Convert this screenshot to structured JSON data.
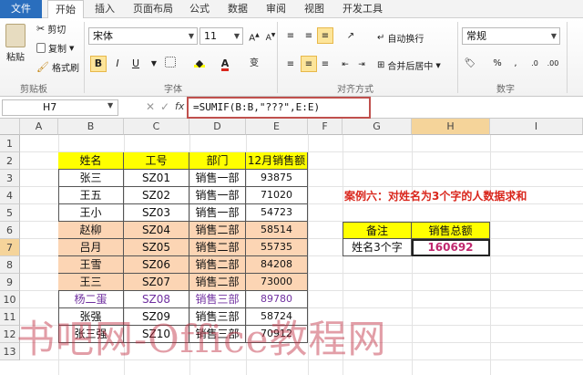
{
  "ribbon_tabs": [
    "文件",
    "开始",
    "插入",
    "页面布局",
    "公式",
    "数据",
    "审阅",
    "视图",
    "开发工具"
  ],
  "clipboard": {
    "paste": "粘贴",
    "cut": "剪切",
    "copy": "复制",
    "format_painter": "格式刷",
    "label": "剪贴板"
  },
  "font": {
    "name": "宋体",
    "size": "11",
    "label": "字体",
    "bold": "B",
    "italic": "I",
    "underline": "U"
  },
  "alignment": {
    "wrap": "自动换行",
    "merge": "合并后居中",
    "label": "对齐方式"
  },
  "number": {
    "format": "常规",
    "label": "数字"
  },
  "formula_bar": {
    "name_box": "H7",
    "fx": "fx",
    "formula": "=SUMIF(B:B,\"???\",E:E)"
  },
  "columns": [
    "A",
    "B",
    "C",
    "D",
    "E",
    "F",
    "G",
    "H",
    "I"
  ],
  "rows": [
    "1",
    "2",
    "3",
    "4",
    "5",
    "6",
    "7",
    "8",
    "9",
    "10",
    "11",
    "12",
    "13"
  ],
  "table": {
    "headers": [
      "姓名",
      "工号",
      "部门",
      "12月销售额"
    ],
    "data": [
      [
        "张三",
        "SZ01",
        "销售一部",
        "93875"
      ],
      [
        "王五",
        "SZ02",
        "销售一部",
        "71020"
      ],
      [
        "王小",
        "SZ03",
        "销售一部",
        "54723"
      ],
      [
        "赵柳",
        "SZ04",
        "销售二部",
        "58514"
      ],
      [
        "吕月",
        "SZ05",
        "销售二部",
        "55735"
      ],
      [
        "王雪",
        "SZ06",
        "销售二部",
        "84208"
      ],
      [
        "王三",
        "SZ07",
        "销售二部",
        "73000"
      ],
      [
        "杨二蛋",
        "SZ08",
        "销售三部",
        "89780"
      ],
      [
        "张强",
        "SZ09",
        "销售三部",
        "58724"
      ],
      [
        "张三强",
        "SZ10",
        "销售三部",
        "70912"
      ]
    ]
  },
  "annotation": "案例六：对姓名为3个字的人数据求和",
  "result": {
    "label_header": "备注",
    "value_header": "销售总额",
    "label": "姓名3个字",
    "value": "160692"
  },
  "watermark": "书吧网-Office教程网",
  "colors": {
    "header_yellow": "#ffff00",
    "orange_rows": "#fcd5b4",
    "purple_text": "#7030a0",
    "annotation_red": "#d9261c",
    "file_tab_blue": "#2a6ebd"
  }
}
